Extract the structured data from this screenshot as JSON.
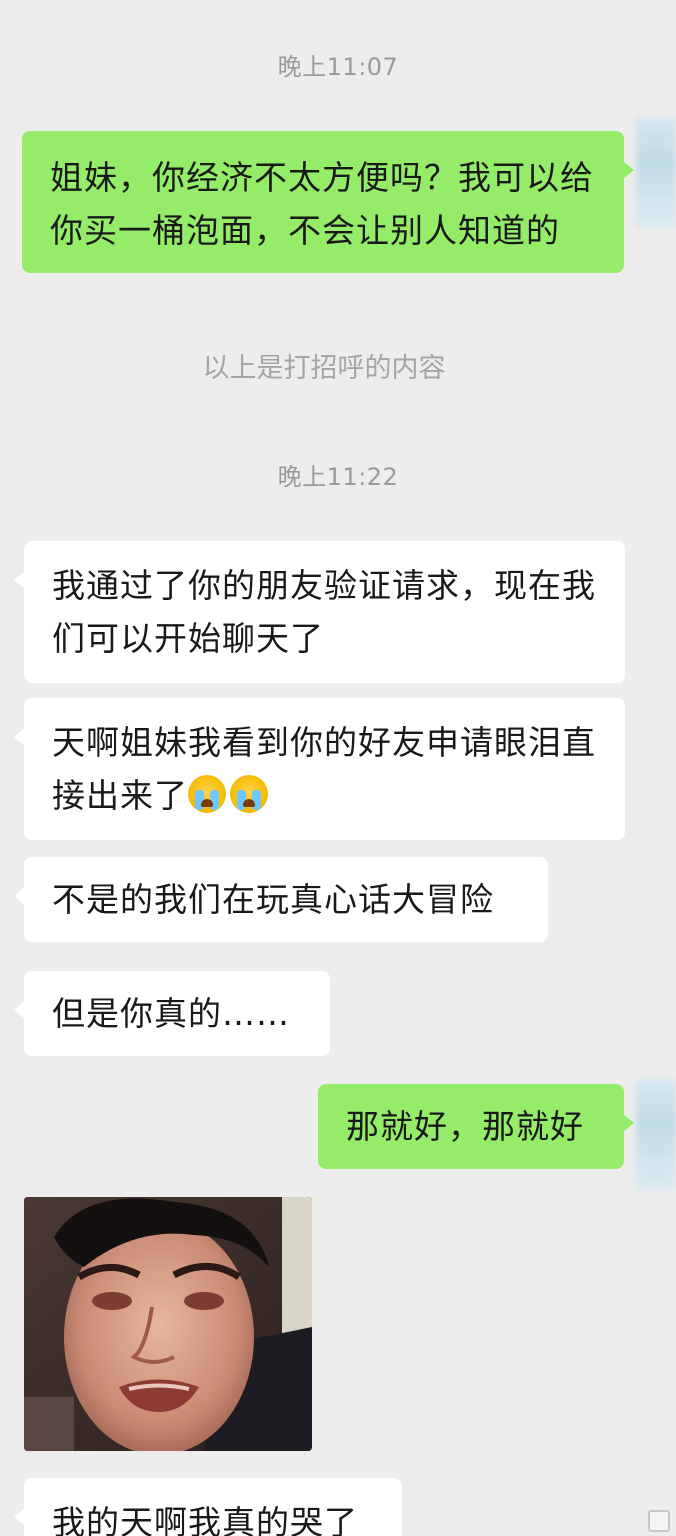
{
  "timestamps": [
    "晚上11:07",
    "晚上11:22"
  ],
  "system_note": "以上是打招呼的内容",
  "messages": {
    "m1": "姐妹，你经济不太方便吗？我可以给你买一桶泡面，不会让别人知道的",
    "m2": "我通过了你的朋友验证请求，现在我们可以开始聊天了",
    "m3": "天啊姐妹我看到你的好友申请眼泪直接出来了",
    "m4": "不是的我们在玩真心话大冒险",
    "m5": "但是你真的……",
    "m6": "那就好，那就好",
    "m7": "我的天啊我真的哭了"
  },
  "icons": {
    "crying": "loudly-crying-face-icon",
    "photo": "crying-man-photo"
  },
  "colors": {
    "background": "#ededed",
    "outgoing_bubble": "#95ec69",
    "incoming_bubble": "#ffffff"
  }
}
